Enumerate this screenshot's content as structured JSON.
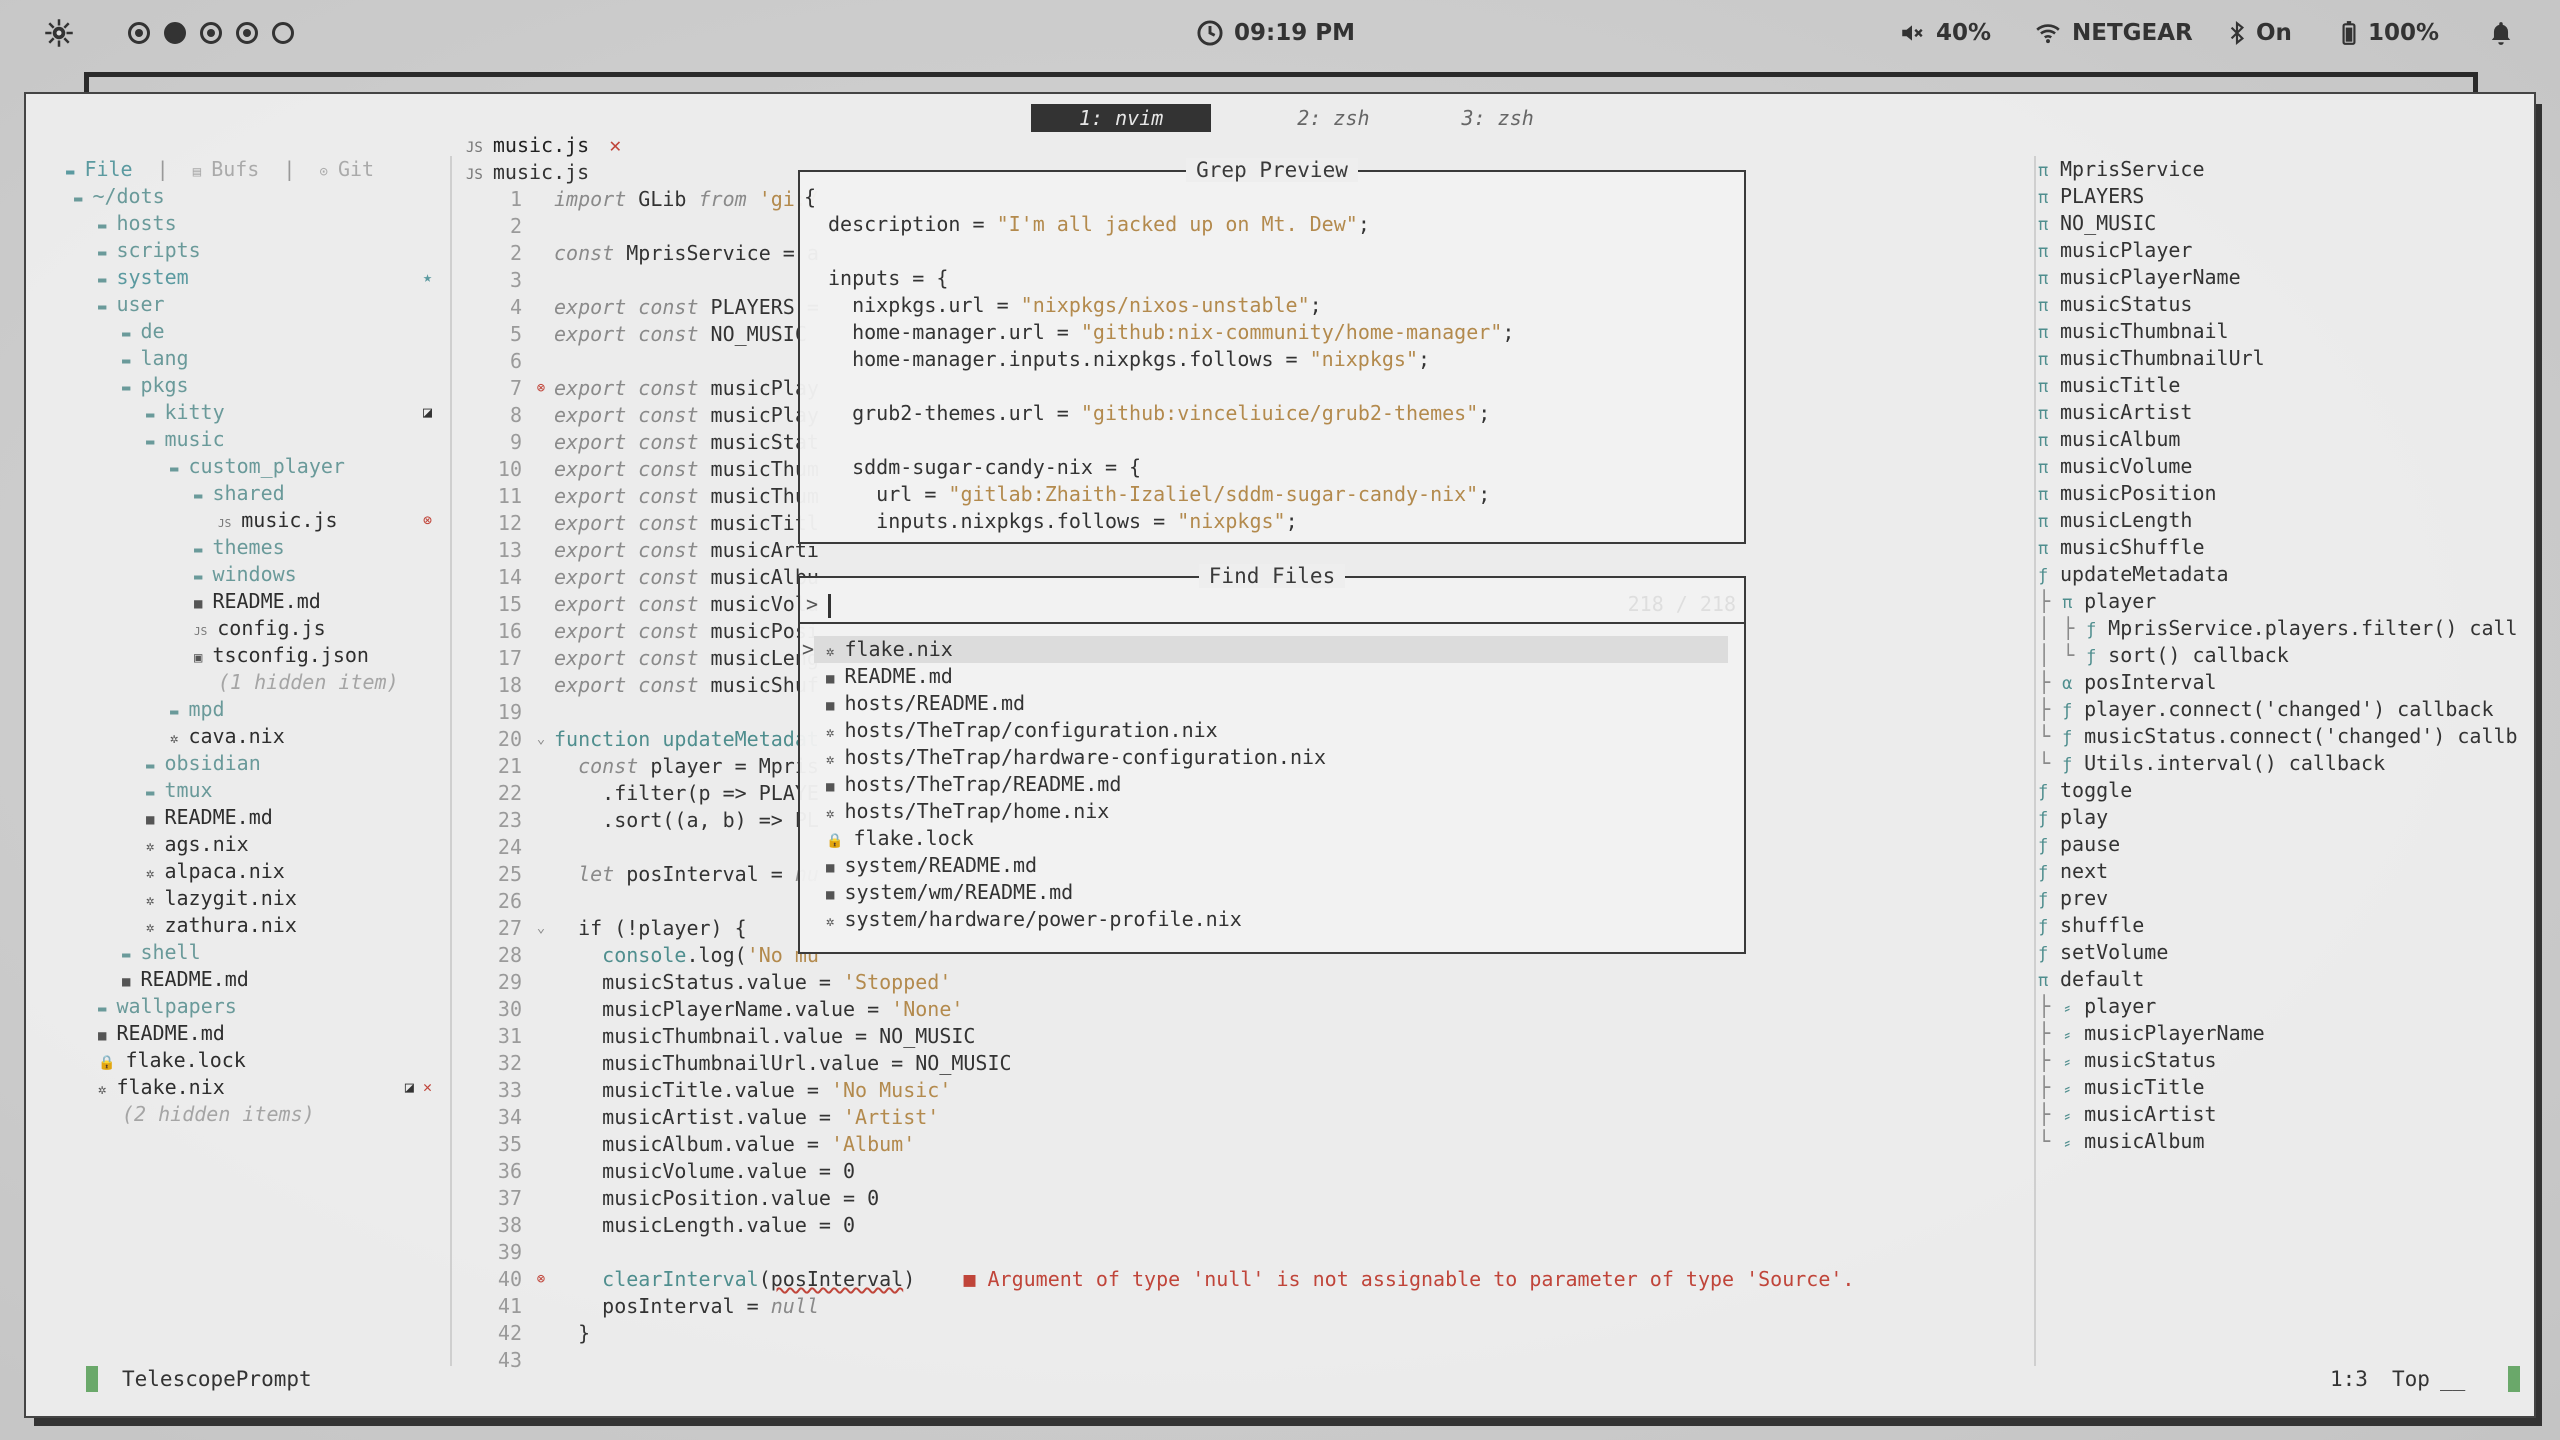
{
  "topbar": {
    "clock": "09:19 PM",
    "volume": "40%",
    "wifi": "NETGEAR",
    "bluetooth": "On",
    "battery": "100%"
  },
  "tmux": {
    "tabs": [
      {
        "label": "1: nvim",
        "active": true
      },
      {
        "label": "2: zsh",
        "active": false
      },
      {
        "label": "3: zsh",
        "active": false
      }
    ]
  },
  "tree": {
    "header": {
      "file": "File",
      "bufs": "Bufs",
      "git": "Git"
    },
    "rows": [
      {
        "label": "~/dots",
        "indent": 0,
        "kind": "dir-open"
      },
      {
        "label": "hosts",
        "indent": 1,
        "kind": "dir"
      },
      {
        "label": "scripts",
        "indent": 1,
        "kind": "dir"
      },
      {
        "label": "system",
        "indent": 1,
        "kind": "dir-sys",
        "mark": "★"
      },
      {
        "label": "user",
        "indent": 1,
        "kind": "dir-open"
      },
      {
        "label": "de",
        "indent": 2,
        "kind": "dir"
      },
      {
        "label": "lang",
        "indent": 2,
        "kind": "dir"
      },
      {
        "label": "pkgs",
        "indent": 2,
        "kind": "dir-open"
      },
      {
        "label": "kitty",
        "indent": 3,
        "kind": "dir",
        "mark": "◪"
      },
      {
        "label": "music",
        "indent": 3,
        "kind": "dir-open"
      },
      {
        "label": "custom_player",
        "indent": 4,
        "kind": "dir-open"
      },
      {
        "label": "shared",
        "indent": 5,
        "kind": "dir-open"
      },
      {
        "label": "music.js",
        "indent": 6,
        "kind": "js",
        "mark": "⊗"
      },
      {
        "label": "themes",
        "indent": 5,
        "kind": "dir"
      },
      {
        "label": "windows",
        "indent": 5,
        "kind": "dir"
      },
      {
        "label": "README.md",
        "indent": 5,
        "kind": "md"
      },
      {
        "label": "config.js",
        "indent": 5,
        "kind": "js"
      },
      {
        "label": "tsconfig.json",
        "indent": 5,
        "kind": "ts"
      },
      {
        "label": "(1 hidden item)",
        "indent": 5,
        "kind": "hidden"
      },
      {
        "label": "mpd",
        "indent": 4,
        "kind": "dir"
      },
      {
        "label": "cava.nix",
        "indent": 4,
        "kind": "nix"
      },
      {
        "label": "obsidian",
        "indent": 3,
        "kind": "dir"
      },
      {
        "label": "tmux",
        "indent": 3,
        "kind": "dir"
      },
      {
        "label": "README.md",
        "indent": 3,
        "kind": "md"
      },
      {
        "label": "ags.nix",
        "indent": 3,
        "kind": "nix"
      },
      {
        "label": "alpaca.nix",
        "indent": 3,
        "kind": "nix"
      },
      {
        "label": "lazygit.nix",
        "indent": 3,
        "kind": "nix"
      },
      {
        "label": "zathura.nix",
        "indent": 3,
        "kind": "nix"
      },
      {
        "label": "shell",
        "indent": 2,
        "kind": "dir"
      },
      {
        "label": "README.md",
        "indent": 2,
        "kind": "md"
      },
      {
        "label": "wallpapers",
        "indent": 1,
        "kind": "dir"
      },
      {
        "label": "README.md",
        "indent": 1,
        "kind": "md"
      },
      {
        "label": "flake.lock",
        "indent": 1,
        "kind": "lock"
      },
      {
        "label": "flake.nix",
        "indent": 1,
        "kind": "nix",
        "mark": "◪ ✕"
      },
      {
        "label": "(2 hidden items)",
        "indent": 1,
        "kind": "hidden"
      }
    ]
  },
  "editor": {
    "tab_title": "music.js",
    "tab_close": "✕",
    "winbar": "music.js",
    "lines": [
      {
        "n": "1",
        "t": "import GLib from 'gi:/"
      },
      {
        "n": "2",
        "t": ""
      },
      {
        "n": "2",
        "t": "const MprisService = a"
      },
      {
        "n": "3",
        "t": ""
      },
      {
        "n": "4",
        "t": "export const PLAYERS ="
      },
      {
        "n": "5",
        "t": "export const NO_MUSIC "
      },
      {
        "n": "6",
        "t": ""
      },
      {
        "n": "7",
        "t": "export const musicPlay",
        "gut": "err"
      },
      {
        "n": "8",
        "t": "export const musicPlay"
      },
      {
        "n": "9",
        "t": "export const musicStat"
      },
      {
        "n": "10",
        "t": "export const musicThum"
      },
      {
        "n": "11",
        "t": "export const musicThum"
      },
      {
        "n": "12",
        "t": "export const musicTitl"
      },
      {
        "n": "13",
        "t": "export const musicArti"
      },
      {
        "n": "14",
        "t": "export const musicAlbu"
      },
      {
        "n": "15",
        "t": "export const musicVolu"
      },
      {
        "n": "16",
        "t": "export const musicPosi"
      },
      {
        "n": "17",
        "t": "export const musicLeng"
      },
      {
        "n": "18",
        "t": "export const musicShuf"
      },
      {
        "n": "19",
        "t": ""
      },
      {
        "n": "20",
        "t": "function updateMetadat",
        "gut": "fold"
      },
      {
        "n": "21",
        "t": "  const player = Mpris"
      },
      {
        "n": "22",
        "t": "    .filter(p => PLAYE"
      },
      {
        "n": "23",
        "t": "    .sort((a, b) => PL"
      },
      {
        "n": "24",
        "t": ""
      },
      {
        "n": "25",
        "t": "  let posInterval = nu"
      },
      {
        "n": "26",
        "t": ""
      },
      {
        "n": "27",
        "t": "  if (!player) {",
        "gut": "fold"
      },
      {
        "n": "28",
        "t": "    console.log('No mu"
      },
      {
        "n": "29",
        "t": "    musicStatus.value = 'Stopped'"
      },
      {
        "n": "30",
        "t": "    musicPlayerName.value = 'None'"
      },
      {
        "n": "31",
        "t": "    musicThumbnail.value = NO_MUSIC"
      },
      {
        "n": "32",
        "t": "    musicThumbnailUrl.value = NO_MUSIC"
      },
      {
        "n": "33",
        "t": "    musicTitle.value = 'No Music'"
      },
      {
        "n": "34",
        "t": "    musicArtist.value = 'Artist'"
      },
      {
        "n": "35",
        "t": "    musicAlbum.value = 'Album'"
      },
      {
        "n": "36",
        "t": "    musicVolume.value = 0"
      },
      {
        "n": "37",
        "t": "    musicPosition.value = 0"
      },
      {
        "n": "38",
        "t": "    musicLength.value = 0"
      },
      {
        "n": "39",
        "t": ""
      },
      {
        "n": "40",
        "t": "    clearInterval(posInterval)",
        "gut": "err"
      },
      {
        "n": "41",
        "t": "    posInterval = null"
      },
      {
        "n": "42",
        "t": "  }"
      },
      {
        "n": "43",
        "t": ""
      }
    ],
    "diagnostic": "■ Argument of type 'null' is not assignable to parameter of type 'Source'."
  },
  "grep_preview": {
    "title": "Grep Preview",
    "lines": [
      "description = \"I'm all jacked up on Mt. Dew\";",
      "",
      "inputs = {",
      "  nixpkgs.url = \"nixpkgs/nixos-unstable\";",
      "  home-manager.url = \"github:nix-community/home-manager\";",
      "  home-manager.inputs.nixpkgs.follows = \"nixpkgs\";",
      "",
      "  grub2-themes.url = \"github:vinceliuice/grub2-themes\";",
      "",
      "  sddm-sugar-candy-nix = {",
      "    url = \"gitlab:Zhaith-Izaliel/sddm-sugar-candy-nix\";",
      "    inputs.nixpkgs.follows = \"nixpkgs\";"
    ],
    "first_char": "{"
  },
  "find_files": {
    "title": "Find Files",
    "prompt": ">",
    "count": "218 / 218",
    "results": [
      {
        "icon": "nix",
        "path": "flake.nix",
        "selected": true
      },
      {
        "icon": "md",
        "path": "README.md"
      },
      {
        "icon": "md",
        "path": "hosts/README.md"
      },
      {
        "icon": "nix",
        "path": "hosts/TheTrap/configuration.nix"
      },
      {
        "icon": "nix",
        "path": "hosts/TheTrap/hardware-configuration.nix"
      },
      {
        "icon": "md",
        "path": "hosts/TheTrap/README.md"
      },
      {
        "icon": "nix",
        "path": "hosts/TheTrap/home.nix"
      },
      {
        "icon": "lock",
        "path": "flake.lock"
      },
      {
        "icon": "md",
        "path": "system/README.md"
      },
      {
        "icon": "md",
        "path": "system/wm/README.md"
      },
      {
        "icon": "nix",
        "path": "system/hardware/power-profile.nix"
      }
    ]
  },
  "outline": {
    "rows": [
      {
        "icon": "π",
        "label": "MprisService",
        "indent": 0
      },
      {
        "icon": "π",
        "label": "PLAYERS",
        "indent": 0
      },
      {
        "icon": "π",
        "label": "NO_MUSIC",
        "indent": 0
      },
      {
        "icon": "π",
        "label": "musicPlayer",
        "indent": 0
      },
      {
        "icon": "π",
        "label": "musicPlayerName",
        "indent": 0
      },
      {
        "icon": "π",
        "label": "musicStatus",
        "indent": 0
      },
      {
        "icon": "π",
        "label": "musicThumbnail",
        "indent": 0
      },
      {
        "icon": "π",
        "label": "musicThumbnailUrl",
        "indent": 0
      },
      {
        "icon": "π",
        "label": "musicTitle",
        "indent": 0
      },
      {
        "icon": "π",
        "label": "musicArtist",
        "indent": 0
      },
      {
        "icon": "π",
        "label": "musicAlbum",
        "indent": 0
      },
      {
        "icon": "π",
        "label": "musicVolume",
        "indent": 0
      },
      {
        "icon": "π",
        "label": "musicPosition",
        "indent": 0
      },
      {
        "icon": "π",
        "label": "musicLength",
        "indent": 0
      },
      {
        "icon": "π",
        "label": "musicShuffle",
        "indent": 0
      },
      {
        "icon": "ƒ",
        "label": "updateMetadata",
        "indent": 0
      },
      {
        "icon": "π",
        "label": "player",
        "indent": 1,
        "guide": "├"
      },
      {
        "icon": "ƒ",
        "label": "MprisService.players.filter() call",
        "indent": 2,
        "guide": "│ ├"
      },
      {
        "icon": "ƒ",
        "label": "sort() callback",
        "indent": 2,
        "guide": "│ └"
      },
      {
        "icon": "α",
        "label": "posInterval",
        "indent": 1,
        "guide": "├"
      },
      {
        "icon": "ƒ",
        "label": "player.connect('changed') callback",
        "indent": 1,
        "guide": "├"
      },
      {
        "icon": "ƒ",
        "label": "musicStatus.connect('changed') callb",
        "indent": 1,
        "guide": "└"
      },
      {
        "icon": "ƒ",
        "label": "Utils.interval() callback",
        "indent": 2,
        "guide": "  └"
      },
      {
        "icon": "ƒ",
        "label": "toggle",
        "indent": 0
      },
      {
        "icon": "ƒ",
        "label": "play",
        "indent": 0
      },
      {
        "icon": "ƒ",
        "label": "pause",
        "indent": 0
      },
      {
        "icon": "ƒ",
        "label": "next",
        "indent": 0
      },
      {
        "icon": "ƒ",
        "label": "prev",
        "indent": 0
      },
      {
        "icon": "ƒ",
        "label": "shuffle",
        "indent": 0
      },
      {
        "icon": "ƒ",
        "label": "setVolume",
        "indent": 0
      },
      {
        "icon": "π",
        "label": "default",
        "indent": 0
      },
      {
        "icon": "⸗",
        "label": "player",
        "indent": 1,
        "guide": "├"
      },
      {
        "icon": "⸗",
        "label": "musicPlayerName",
        "indent": 1,
        "guide": "├"
      },
      {
        "icon": "⸗",
        "label": "musicStatus",
        "indent": 1,
        "guide": "├"
      },
      {
        "icon": "⸗",
        "label": "musicTitle",
        "indent": 1,
        "guide": "├"
      },
      {
        "icon": "⸗",
        "label": "musicArtist",
        "indent": 1,
        "guide": "├"
      },
      {
        "icon": "⸗",
        "label": "musicAlbum",
        "indent": 1,
        "guide": "└"
      }
    ]
  },
  "statusline": {
    "mode": "TelescopePrompt",
    "position": "1:3",
    "scroll": "Top",
    "cursor": "__"
  }
}
